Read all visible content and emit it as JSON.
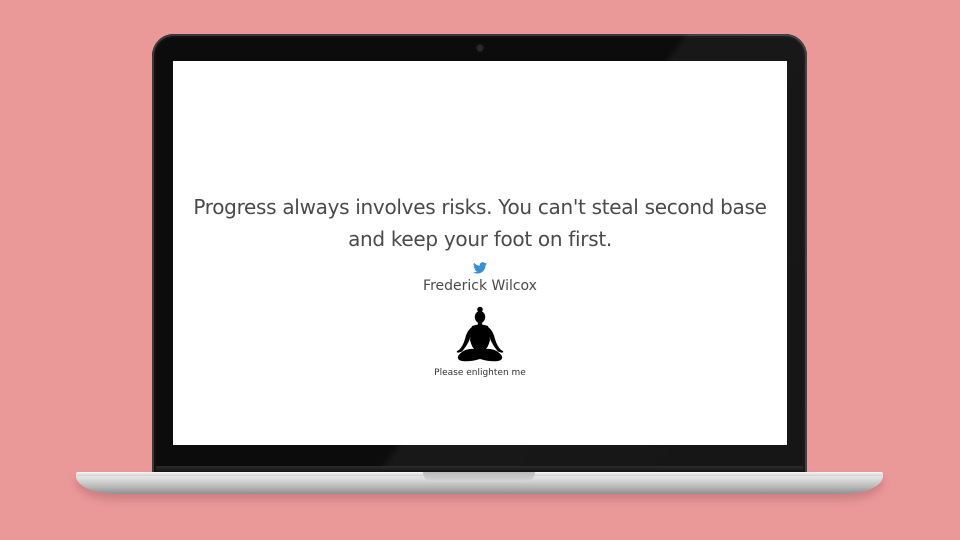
{
  "quote": {
    "text": "Progress always involves risks. You can't steal second base and keep your foot on first.",
    "author": "Frederick Wilcox"
  },
  "actions": {
    "tweet_icon": "twitter-bird-icon",
    "enlighten_icon": "meditation-figure-icon",
    "enlighten_label": "Please enlighten me"
  },
  "colors": {
    "background": "#eb9899",
    "screen": "#ffffff",
    "text": "#4a4a4a",
    "twitter": "#3a8fd6"
  }
}
